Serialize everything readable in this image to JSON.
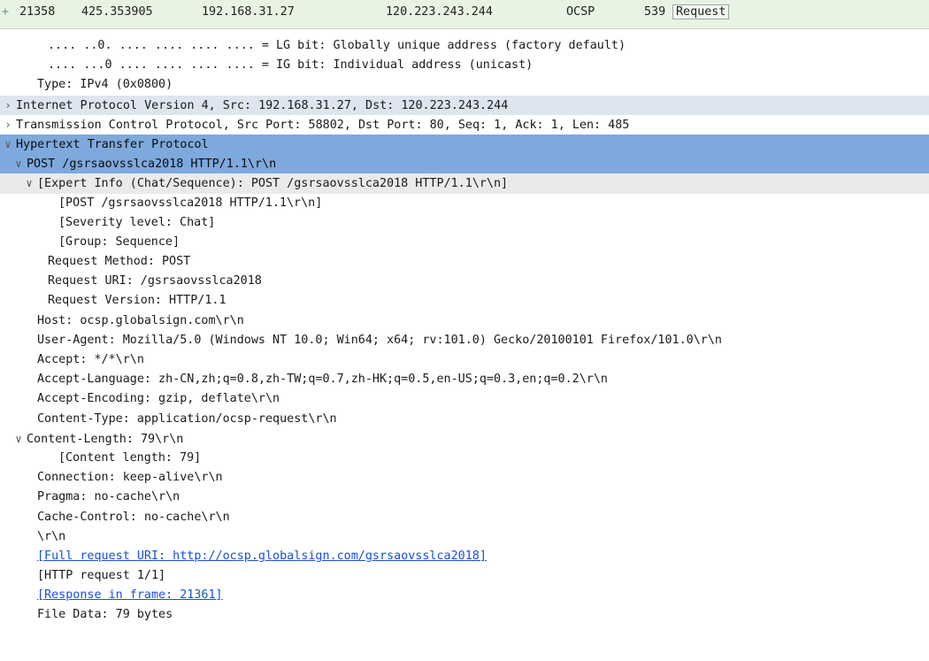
{
  "packet_list": {
    "row": {
      "arrow": "+",
      "no": "21358",
      "time": "425.353905",
      "src": "192.168.31.27",
      "dst": "120.223.243.244",
      "proto": "OCSP",
      "len": "539",
      "info": "Request"
    }
  },
  "tree": [
    {
      "indent": 3,
      "toggle": "",
      "text": ".... ..0. .... .... .... .... = LG bit: Globally unique address (factory default)",
      "style": "normal"
    },
    {
      "indent": 3,
      "toggle": "",
      "text": ".... ...0 .... .... .... .... = IG bit: Individual address (unicast)",
      "style": "normal"
    },
    {
      "indent": 2,
      "toggle": "",
      "text": "Type: IPv4 (0x0800)",
      "style": "normal"
    },
    {
      "indent": 0,
      "toggle": ">",
      "text": "Internet Protocol Version 4, Src: 192.168.31.27, Dst: 120.223.243.244",
      "style": "summary"
    },
    {
      "indent": 0,
      "toggle": ">",
      "text": "Transmission Control Protocol, Src Port: 58802, Dst Port: 80, Seq: 1, Ack: 1, Len: 485",
      "style": "normal"
    },
    {
      "indent": 0,
      "toggle": "v",
      "text": "Hypertext Transfer Protocol",
      "style": "selected"
    },
    {
      "indent": 1,
      "toggle": "v",
      "text": "POST /gsrsaovsslca2018 HTTP/1.1\\r\\n",
      "style": "selected"
    },
    {
      "indent": 2,
      "toggle": "v",
      "text": "[Expert Info (Chat/Sequence): POST /gsrsaovsslca2018 HTTP/1.1\\r\\n]",
      "style": "subhead"
    },
    {
      "indent": 4,
      "toggle": "",
      "text": "[POST /gsrsaovsslca2018 HTTP/1.1\\r\\n]",
      "style": "normal"
    },
    {
      "indent": 4,
      "toggle": "",
      "text": "[Severity level: Chat]",
      "style": "normal"
    },
    {
      "indent": 4,
      "toggle": "",
      "text": "[Group: Sequence]",
      "style": "normal"
    },
    {
      "indent": 3,
      "toggle": "",
      "text": "Request Method: POST",
      "style": "normal"
    },
    {
      "indent": 3,
      "toggle": "",
      "text": "Request URI: /gsrsaovsslca2018",
      "style": "normal"
    },
    {
      "indent": 3,
      "toggle": "",
      "text": "Request Version: HTTP/1.1",
      "style": "normal"
    },
    {
      "indent": 2,
      "toggle": "",
      "text": "Host: ocsp.globalsign.com\\r\\n",
      "style": "normal"
    },
    {
      "indent": 2,
      "toggle": "",
      "text": "User-Agent: Mozilla/5.0 (Windows NT 10.0; Win64; x64; rv:101.0) Gecko/20100101 Firefox/101.0\\r\\n",
      "style": "normal"
    },
    {
      "indent": 2,
      "toggle": "",
      "text": "Accept: */*\\r\\n",
      "style": "normal"
    },
    {
      "indent": 2,
      "toggle": "",
      "text": "Accept-Language: zh-CN,zh;q=0.8,zh-TW;q=0.7,zh-HK;q=0.5,en-US;q=0.3,en;q=0.2\\r\\n",
      "style": "normal"
    },
    {
      "indent": 2,
      "toggle": "",
      "text": "Accept-Encoding: gzip, deflate\\r\\n",
      "style": "normal"
    },
    {
      "indent": 2,
      "toggle": "",
      "text": "Content-Type: application/ocsp-request\\r\\n",
      "style": "normal"
    },
    {
      "indent": 1,
      "toggle": "v",
      "text": "Content-Length: 79\\r\\n",
      "style": "normal"
    },
    {
      "indent": 4,
      "toggle": "",
      "text": "[Content length: 79]",
      "style": "normal"
    },
    {
      "indent": 2,
      "toggle": "",
      "text": "Connection: keep-alive\\r\\n",
      "style": "normal"
    },
    {
      "indent": 2,
      "toggle": "",
      "text": "Pragma: no-cache\\r\\n",
      "style": "normal"
    },
    {
      "indent": 2,
      "toggle": "",
      "text": "Cache-Control: no-cache\\r\\n",
      "style": "normal"
    },
    {
      "indent": 2,
      "toggle": "",
      "text": "\\r\\n",
      "style": "normal"
    },
    {
      "indent": 2,
      "toggle": "",
      "text": "[Full request URI: http://ocsp.globalsign.com/gsrsaovsslca2018]",
      "style": "link"
    },
    {
      "indent": 2,
      "toggle": "",
      "text": "[HTTP request 1/1]",
      "style": "normal"
    },
    {
      "indent": 2,
      "toggle": "",
      "text": "[Response in frame: 21361]",
      "style": "link"
    },
    {
      "indent": 2,
      "toggle": "",
      "text": "File Data: 79 bytes",
      "style": "normal"
    }
  ],
  "colors": {
    "selected_row": "#7ea9dd",
    "summary_row": "#dde6ef",
    "link": "#1a4fd6",
    "packet_list_bg": "#e8f4e3"
  }
}
